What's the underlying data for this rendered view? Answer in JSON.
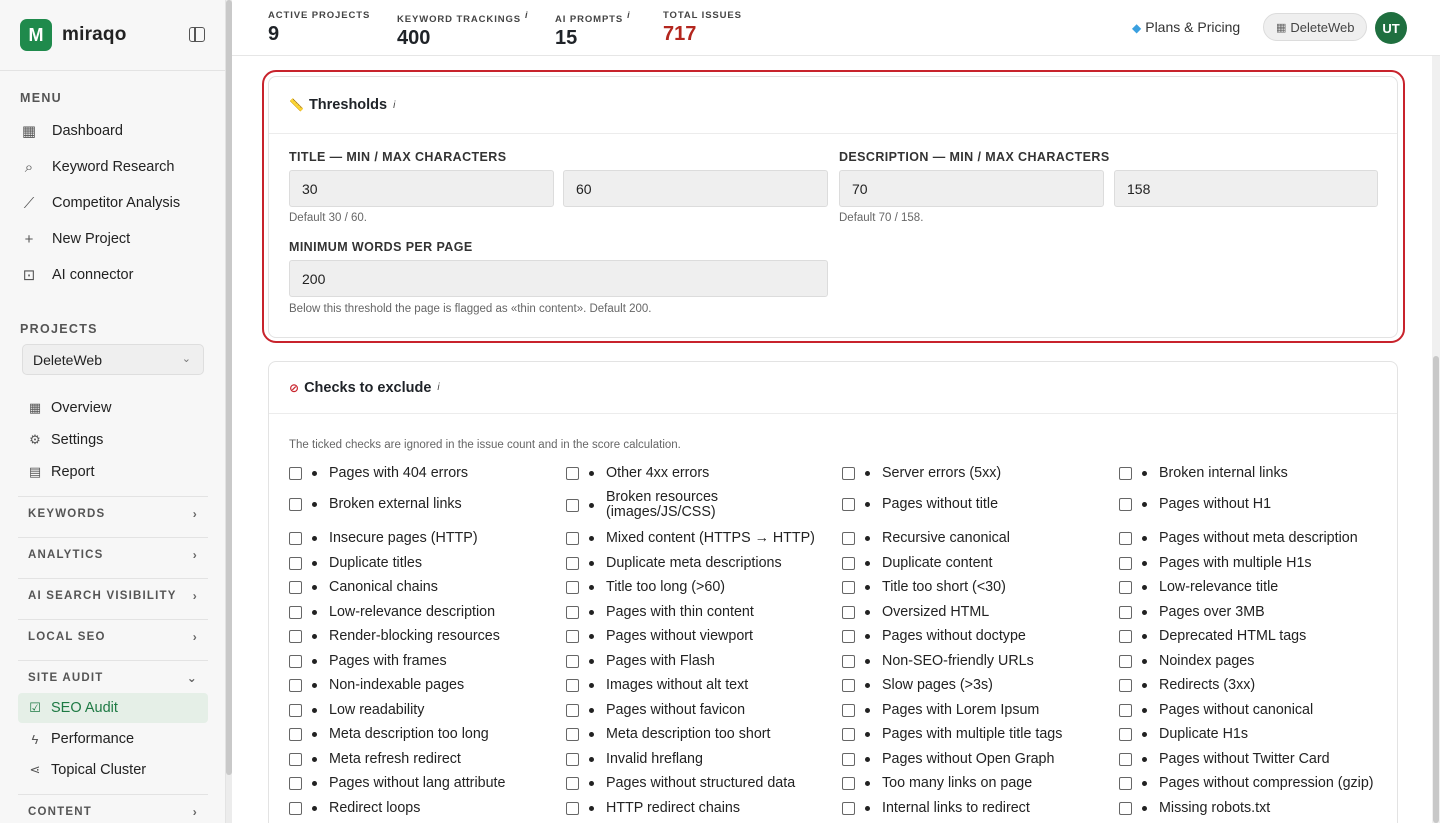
{
  "app": {
    "name": "miraqo",
    "logo_letter": "M"
  },
  "sidebar": {
    "menu_label": "MENU",
    "menu": [
      {
        "label": "Dashboard",
        "icon": "grid-icon"
      },
      {
        "label": "Keyword Research",
        "icon": "search-icon"
      },
      {
        "label": "Competitor Analysis",
        "icon": "chart-icon"
      },
      {
        "label": "New Project",
        "icon": "plus-icon"
      },
      {
        "label": "AI connector",
        "icon": "robot-icon"
      }
    ],
    "projects_label": "PROJECTS",
    "project_selected": "DeleteWeb",
    "project_items": [
      {
        "label": "Overview",
        "icon": "grid-icon"
      },
      {
        "label": "Settings",
        "icon": "gear-icon"
      },
      {
        "label": "Report",
        "icon": "document-icon"
      }
    ],
    "groups": [
      {
        "label": "KEYWORDS"
      },
      {
        "label": "ANALYTICS"
      },
      {
        "label": "AI SEARCH VISIBILITY"
      },
      {
        "label": "LOCAL SEO"
      },
      {
        "label": "SITE AUDIT"
      },
      {
        "label": "CONTENT"
      }
    ],
    "site_audit_items": [
      {
        "label": "SEO Audit",
        "icon": "checkbox-icon",
        "active": true
      },
      {
        "label": "Performance",
        "icon": "bolt-icon"
      },
      {
        "label": "Topical Cluster",
        "icon": "share-icon"
      }
    ]
  },
  "topbar": {
    "stats": [
      {
        "label": "ACTIVE PROJECTS",
        "value": "9",
        "info": ""
      },
      {
        "label": "KEYWORD TRACKINGS",
        "value": "400",
        "info": "i"
      },
      {
        "label": "AI PROMPTS",
        "value": "15",
        "info": "i"
      },
      {
        "label": "TOTAL ISSUES",
        "value": "717",
        "info": ""
      }
    ],
    "plans_label": "Plans & Pricing",
    "workspace": "DeleteWeb",
    "avatar_initials": "UT"
  },
  "thresholds": {
    "title": "Thresholds",
    "info": "i",
    "title_label": "TITLE — MIN / MAX CHARACTERS",
    "title_min": "30",
    "title_max": "60",
    "title_hint": "Default 30 / 60.",
    "desc_label": "DESCRIPTION — MIN / MAX CHARACTERS",
    "desc_min": "70",
    "desc_max": "158",
    "desc_hint": "Default 70 / 158.",
    "words_label": "MINIMUM WORDS PER PAGE",
    "words_value": "200",
    "words_hint": "Below this threshold the page is flagged as «thin content». Default 200."
  },
  "exclude": {
    "title": "Checks to exclude",
    "info": "i",
    "hint": "The ticked checks are ignored in the issue count and in the score calculation.",
    "columns": [
      [
        "Pages with 404 errors",
        "Broken external links",
        "Insecure pages (HTTP)",
        "Duplicate titles",
        "Canonical chains",
        "Low-relevance description",
        "Render-blocking resources",
        "Pages with frames",
        "Non-indexable pages",
        "Low readability",
        "Meta description too long",
        "Meta refresh redirect",
        "Pages without lang attribute",
        "Redirect loops"
      ],
      [
        "Other 4xx errors",
        "Broken resources (images/JS/CSS)",
        "Mixed content (HTTPS → HTTP)",
        "Duplicate meta descriptions",
        "Title too long (>60)",
        "Pages with thin content",
        "Pages without viewport",
        "Pages with Flash",
        "Images without alt text",
        "Pages without favicon",
        "Meta description too short",
        "Invalid hreflang",
        "Pages without structured data",
        "HTTP redirect chains"
      ],
      [
        "Server errors (5xx)",
        "Pages without title",
        "Recursive canonical",
        "Duplicate content",
        "Title too short (<30)",
        "Oversized HTML",
        "Pages without doctype",
        "Non-SEO-friendly URLs",
        "Slow pages (>3s)",
        "Pages with Lorem Ipsum",
        "Pages with multiple title tags",
        "Pages without Open Graph",
        "Too many links on page",
        "Internal links to redirect"
      ],
      [
        "Broken internal links",
        "Pages without H1",
        "Pages without meta description",
        "Pages with multiple H1s",
        "Low-relevance title",
        "Pages over 3MB",
        "Deprecated HTML tags",
        "Noindex pages",
        "Redirects (3xx)",
        "Pages without canonical",
        "Duplicate H1s",
        "Pages without Twitter Card",
        "Pages without compression (gzip)",
        "Missing robots.txt"
      ]
    ]
  }
}
